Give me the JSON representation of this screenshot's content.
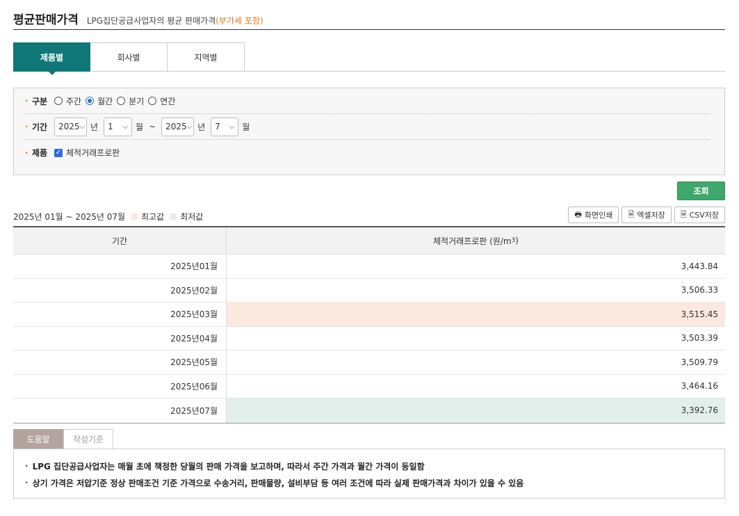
{
  "header": {
    "title": "평균판매가격",
    "subtitle": "LPG집단공급사업자의 평균 판매가격",
    "vat_note": "(부가세 포함)"
  },
  "tabs": [
    {
      "label": "제품별",
      "active": true
    },
    {
      "label": "회사별",
      "active": false
    },
    {
      "label": "지역별",
      "active": false
    }
  ],
  "filter": {
    "period_type": {
      "label": "구분",
      "options": [
        "주간",
        "월간",
        "분기",
        "연간"
      ],
      "selected": "월간"
    },
    "date_range": {
      "label": "기간",
      "start_year": "2025",
      "start_month": "1",
      "end_year": "2025",
      "end_month": "7",
      "year_unit": "년",
      "month_unit": "월",
      "separator": "~"
    },
    "product": {
      "label": "제품",
      "option": "체적거래프로판",
      "checked": true
    }
  },
  "search_button": "조회",
  "result": {
    "range_text": "2025년 01월 ~ 2025년 07월",
    "legend_max": "최고값",
    "legend_min": "최저값",
    "max_color": "#fbe8df",
    "min_color": "#e3efea"
  },
  "actions": {
    "print": "화면인쇄",
    "excel": "엑셀저장",
    "csv": "CSV저장"
  },
  "table": {
    "col_period": "기간",
    "col_value": "체적거래프로판 (원/m",
    "col_value_sup": "3",
    "col_value_close": ")",
    "rows": [
      {
        "period": "2025년01월",
        "value": "3,443.84",
        "mark": ""
      },
      {
        "period": "2025년02월",
        "value": "3,506.33",
        "mark": ""
      },
      {
        "period": "2025년03월",
        "value": "3,515.45",
        "mark": "max"
      },
      {
        "period": "2025년04월",
        "value": "3,503.39",
        "mark": ""
      },
      {
        "period": "2025년05월",
        "value": "3,509.79",
        "mark": ""
      },
      {
        "period": "2025년06월",
        "value": "3,464.16",
        "mark": ""
      },
      {
        "period": "2025년07월",
        "value": "3,392.76",
        "mark": "min"
      }
    ]
  },
  "help": {
    "tab_help": "도움말",
    "tab_criteria": "작성기준",
    "lines": [
      "LPG 집단공급사업자는 매월 초에 책정한 당월의 판매 가격을 보고하며, 따라서 주간 가격과 월간 가격이 동일함",
      "상기 가격은 저압기준 정상 판매조건 기준 가격으로 수송거리, 판매물량, 설비부담 등 여러 조건에 따라 실제 판매가격과 차이가 있을 수 있음"
    ]
  }
}
